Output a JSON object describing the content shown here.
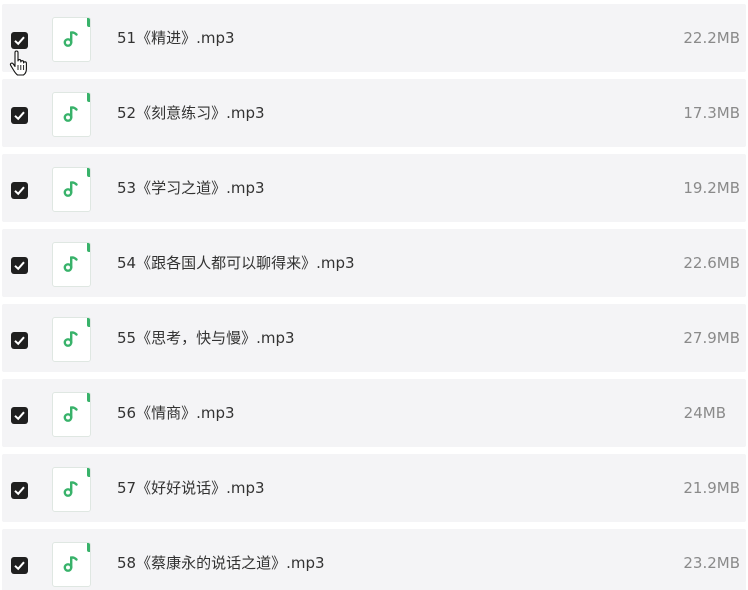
{
  "files": [
    {
      "name": "51《精进》.mp3",
      "size": "22.2MB",
      "checked": true,
      "icon": "music-note-icon"
    },
    {
      "name": "52《刻意练习》.mp3",
      "size": "17.3MB",
      "checked": true,
      "icon": "music-note-icon"
    },
    {
      "name": "53《学习之道》.mp3",
      "size": "19.2MB",
      "checked": true,
      "icon": "music-note-icon"
    },
    {
      "name": "54《跟各国人都可以聊得来》.mp3",
      "size": "22.6MB",
      "checked": true,
      "icon": "music-note-icon"
    },
    {
      "name": "55《思考，快与慢》.mp3",
      "size": "27.9MB",
      "checked": true,
      "icon": "music-note-icon"
    },
    {
      "name": "56《情商》.mp3",
      "size": "24MB",
      "checked": true,
      "icon": "music-note-icon"
    },
    {
      "name": "57《好好说话》.mp3",
      "size": "21.9MB",
      "checked": true,
      "icon": "music-note-icon"
    },
    {
      "name": "58《蔡康永的说话之道》.mp3",
      "size": "23.2MB",
      "checked": true,
      "icon": "music-note-icon"
    }
  ],
  "colors": {
    "row_background": "#f4f4f6",
    "checkbox": "#1f1f1f",
    "icon_accent": "#38b26a",
    "name_text": "#333333",
    "size_text": "#8a8a8a"
  },
  "cursor": "hand-pointer-icon"
}
